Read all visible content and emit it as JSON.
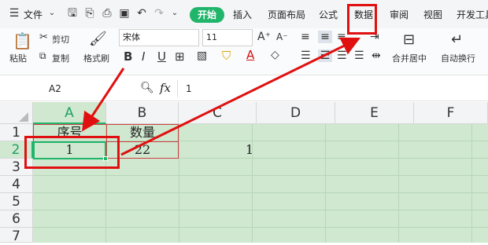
{
  "menu": {
    "file_label": "文件"
  },
  "tabs": [
    {
      "label": "开始",
      "active": true
    },
    {
      "label": "插入"
    },
    {
      "label": "页面布局"
    },
    {
      "label": "公式"
    },
    {
      "label": "数据"
    },
    {
      "label": "审阅"
    },
    {
      "label": "视图"
    },
    {
      "label": "开发工具"
    }
  ],
  "ribbon": {
    "paste": "粘贴",
    "cut": "剪切",
    "copy": "复制",
    "format_painter": "格式刷",
    "font_name": "宋体",
    "font_size": "11",
    "merge_center": "合并居中",
    "wrap_text": "自动换行"
  },
  "formula_bar": {
    "cell_ref": "A2",
    "fx": "fx",
    "value": "1"
  },
  "columns": [
    "A",
    "B",
    "C",
    "D",
    "E",
    "F"
  ],
  "rows": [
    "1",
    "2",
    "3",
    "4",
    "5",
    "6",
    "7"
  ],
  "cells": {
    "A1": "序号",
    "B1": "数量",
    "A2": "1",
    "B2": "22",
    "C2": "1"
  },
  "colors": {
    "accent": "#20b56b",
    "highlight": "#e01010",
    "grid_fill": "#cfe8cf"
  }
}
